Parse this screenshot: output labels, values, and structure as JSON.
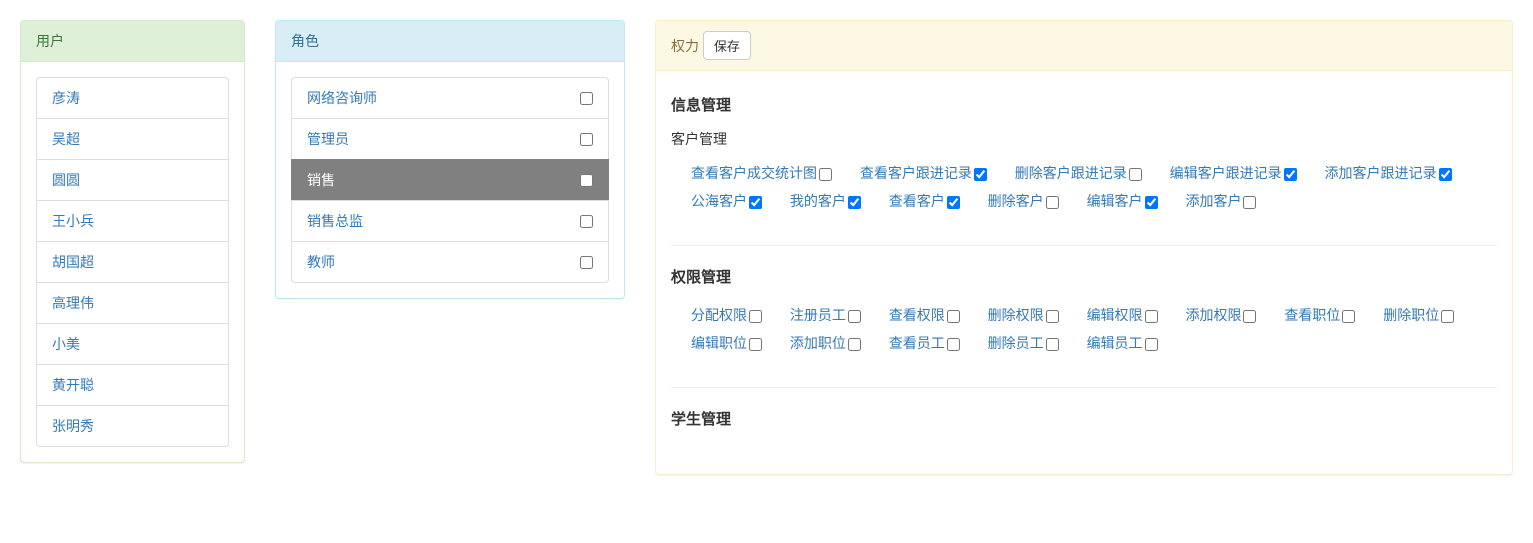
{
  "users_panel": {
    "title": "用户"
  },
  "users": [
    "彦涛",
    "吴超",
    "圆圆",
    "王小兵",
    "胡国超",
    "高理伟",
    "小美",
    "黄开聪",
    "张明秀"
  ],
  "roles_panel": {
    "title": "角色"
  },
  "roles": [
    {
      "name": "网络咨询师",
      "checked": false,
      "active": false
    },
    {
      "name": "管理员",
      "checked": false,
      "active": false
    },
    {
      "name": "销售",
      "checked": false,
      "active": true
    },
    {
      "name": "销售总监",
      "checked": false,
      "active": false
    },
    {
      "name": "教师",
      "checked": false,
      "active": false
    }
  ],
  "perms_panel": {
    "title": "权力",
    "save_label": "保存"
  },
  "perm_groups": [
    {
      "title": "信息管理",
      "subgroups": [
        {
          "title": "客户管理",
          "perms": [
            {
              "label": "查看客户成交统计图",
              "checked": false
            },
            {
              "label": "查看客户跟进记录",
              "checked": true
            },
            {
              "label": "删除客户跟进记录",
              "checked": false
            },
            {
              "label": "编辑客户跟进记录",
              "checked": true
            },
            {
              "label": "添加客户跟进记录",
              "checked": true
            },
            {
              "label": "公海客户",
              "checked": true
            },
            {
              "label": "我的客户",
              "checked": true
            },
            {
              "label": "查看客户",
              "checked": true
            },
            {
              "label": "删除客户",
              "checked": false
            },
            {
              "label": "编辑客户",
              "checked": true
            },
            {
              "label": "添加客户",
              "checked": false
            }
          ]
        }
      ]
    },
    {
      "title": "权限管理",
      "subgroups": [
        {
          "title": "",
          "perms": [
            {
              "label": "分配权限",
              "checked": false
            },
            {
              "label": "注册员工",
              "checked": false
            },
            {
              "label": "查看权限",
              "checked": false
            },
            {
              "label": "删除权限",
              "checked": false
            },
            {
              "label": "编辑权限",
              "checked": false
            },
            {
              "label": "添加权限",
              "checked": false
            },
            {
              "label": "查看职位",
              "checked": false
            },
            {
              "label": "删除职位",
              "checked": false
            },
            {
              "label": "编辑职位",
              "checked": false
            },
            {
              "label": "添加职位",
              "checked": false
            },
            {
              "label": "查看员工",
              "checked": false
            },
            {
              "label": "删除员工",
              "checked": false
            },
            {
              "label": "编辑员工",
              "checked": false
            }
          ]
        }
      ]
    },
    {
      "title": "学生管理",
      "subgroups": []
    }
  ]
}
